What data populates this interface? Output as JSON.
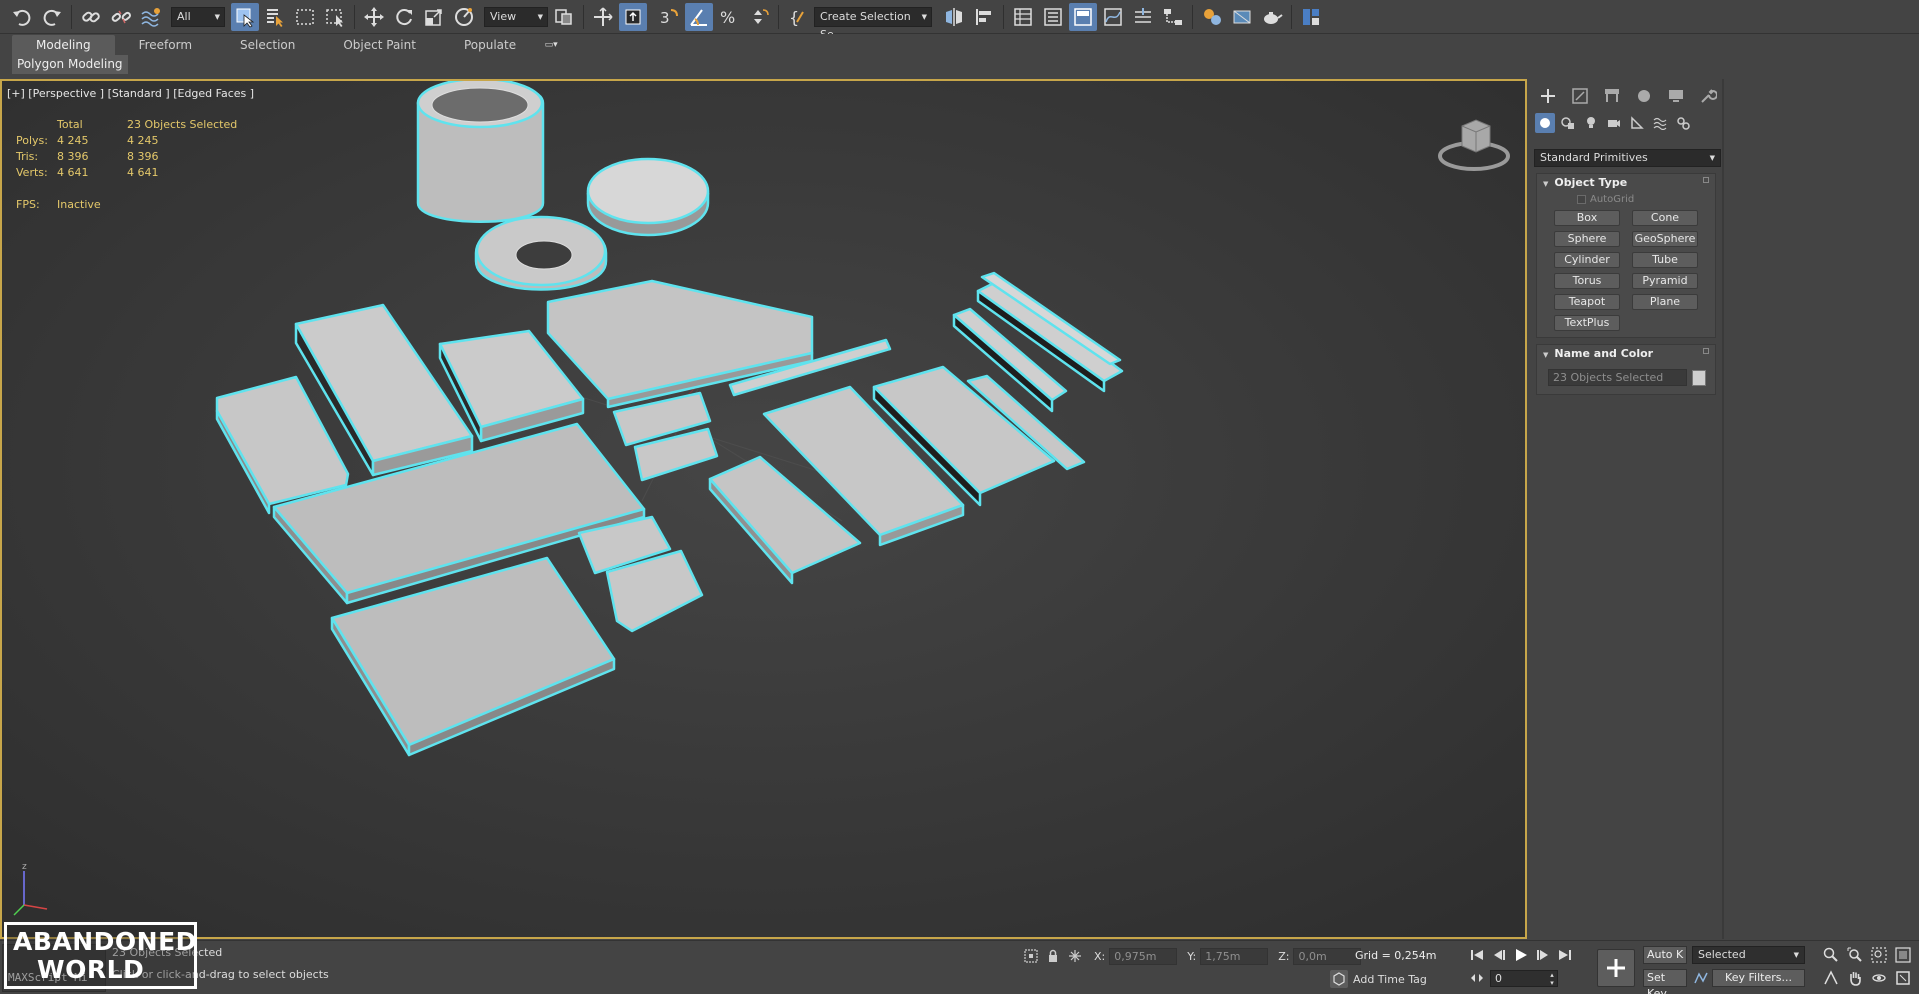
{
  "toolbar": {
    "selection_filter": "All",
    "ref_coord_system": "View",
    "named_selection_set": "Create Selection Se"
  },
  "ribbon": {
    "tabs": [
      "Modeling",
      "Freeform",
      "Selection",
      "Object Paint",
      "Populate"
    ],
    "active_tab": "Modeling",
    "subpanel": "Polygon Modeling"
  },
  "viewport": {
    "label": "[+] [Perspective ] [Standard ] [Edged Faces ]",
    "stats": {
      "header_total": "Total",
      "header_selected": "23 Objects Selected",
      "polys_label": "Polys:",
      "polys_total": "4 245",
      "polys_selected": "4 245",
      "tris_label": "Tris:",
      "tris_total": "8 396",
      "tris_selected": "8 396",
      "verts_label": "Verts:",
      "verts_total": "4 641",
      "verts_selected": "4 641",
      "fps_label": "FPS:",
      "fps_value": "Inactive"
    },
    "colors": {
      "viewport_bg": "#3c3c3c",
      "active_border": "#c7a64a",
      "selection_outline": "#5fe3ee",
      "mesh_fill": "#b7b7b7",
      "stats_text": "#e4c86a"
    }
  },
  "command_panel": {
    "category": "Standard Primitives",
    "object_type_title": "Object Type",
    "autogrid_label": "AutoGrid",
    "primitives": [
      "Box",
      "Cone",
      "Sphere",
      "GeoSphere",
      "Cylinder",
      "Tube",
      "Torus",
      "Pyramid",
      "Teapot",
      "Plane",
      "TextPlus"
    ],
    "name_color_title": "Name and Color",
    "name_value": "23 Objects Selected"
  },
  "status_bar": {
    "maxscript": "MAXScript Mi",
    "selection": "23 Objects Selected",
    "prompt": "Click or click-and-drag to select objects",
    "x_label": "X:",
    "x_value": "0,975m",
    "y_label": "Y:",
    "y_value": "1,75m",
    "z_label": "Z:",
    "z_value": "0,0m",
    "grid": "Grid = 0,254m",
    "add_time_tag": "Add Time Tag",
    "frame": "0",
    "auto_key": "Auto K",
    "set_key": "Set Key",
    "key_mode": "Selected",
    "key_filters": "Key Filters..."
  },
  "watermark": {
    "text_line1": "ABANDONED",
    "text_line2": "WORLD"
  }
}
